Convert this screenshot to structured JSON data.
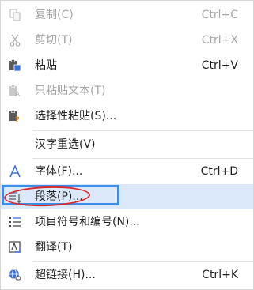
{
  "menu": {
    "copy": {
      "label": "复制(C)",
      "shortcut": "Ctrl+C",
      "icon": "copy-icon"
    },
    "cut": {
      "label": "剪切(T)",
      "shortcut": "Ctrl+X",
      "icon": "scissors-icon"
    },
    "paste": {
      "label": "粘贴",
      "shortcut": "Ctrl+V",
      "icon": "paste-icon"
    },
    "paste_text_only": {
      "label": "只粘贴文本(T)",
      "icon": "paste-text-icon"
    },
    "paste_special": {
      "label": "选择性粘贴(S)...",
      "icon": "paste-special-icon"
    },
    "reselect_hanzi": {
      "label": "汉字重选(V)"
    },
    "font": {
      "label": "字体(F)...",
      "shortcut": "Ctrl+D",
      "icon": "font-icon"
    },
    "paragraph": {
      "label": "段落(P)...",
      "icon": "paragraph-icon"
    },
    "bullets_numbering": {
      "label": "项目符号和编号(N)...",
      "icon": "list-icon"
    },
    "translate": {
      "label": "翻译(T)",
      "icon": "translate-icon"
    },
    "hyperlink": {
      "label": "超链接(H)...",
      "shortcut": "Ctrl+K",
      "icon": "hyperlink-icon"
    }
  },
  "colors": {
    "hover": "#dce9fb",
    "highlight_box": "#3b8de8",
    "annotation": "#d82b2b",
    "disabled_text": "#a6a6a6"
  }
}
